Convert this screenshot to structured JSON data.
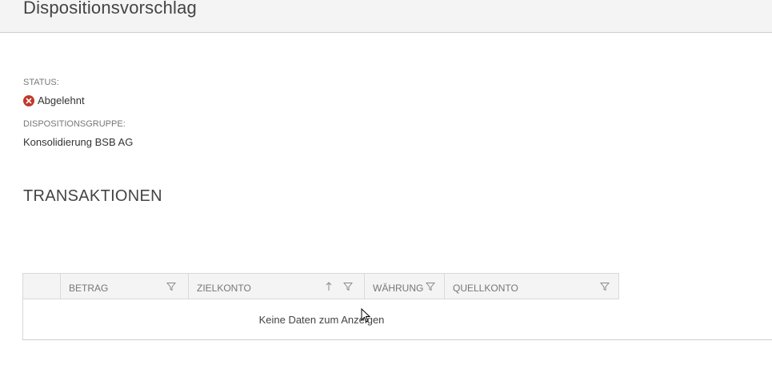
{
  "header": {
    "title": "Dispositionsvorschlag"
  },
  "details": {
    "status_label": "STATUS:",
    "status_value": "Abgelehnt",
    "status_icon": "error-circle-icon",
    "group_label": "DISPOSITIONSGRUPPE:",
    "group_value": "Konsolidierung BSB AG"
  },
  "transactions": {
    "title": "TRANSAKTIONEN",
    "columns": [
      {
        "label": "BETRAG",
        "filter": true,
        "sort": ""
      },
      {
        "label": "ZIELKONTO",
        "filter": true,
        "sort": "ascending"
      },
      {
        "label": "WÄHRUNG",
        "filter": true,
        "sort": ""
      },
      {
        "label": "QUELLKONTO",
        "filter": true,
        "sort": ""
      }
    ],
    "empty_text": "Keine Daten zum Anzeigen"
  },
  "colors": {
    "error": "#c0392b",
    "header_bg": "#f4f4f4"
  }
}
